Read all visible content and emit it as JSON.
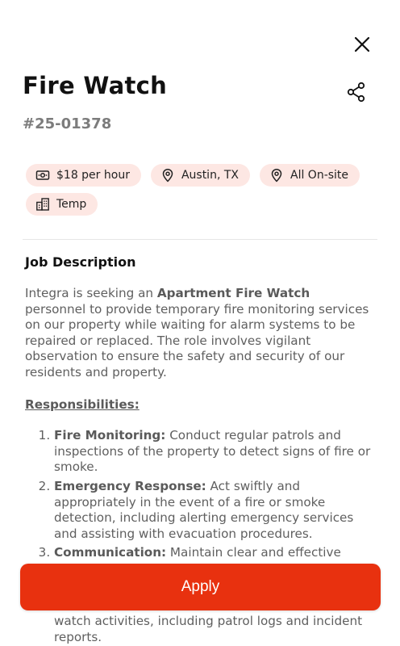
{
  "header": {
    "close_icon": "close-icon",
    "share_icon": "share-icon",
    "title": "Fire Watch",
    "job_id": "#25-01378"
  },
  "chips": [
    {
      "icon": "cash-icon",
      "label": "$18 per hour"
    },
    {
      "icon": "location-pin-icon",
      "label": "Austin, TX"
    },
    {
      "icon": "location-pin-icon",
      "label": "All On-site"
    },
    {
      "icon": "building-icon",
      "label": "Temp"
    }
  ],
  "description": {
    "section_title": "Job Description",
    "intro": {
      "part1": "Integra is seeking an ",
      "bold": "Apartment Fire Watch",
      "part2": " personnel to provide temporary fire monitoring services on our property while waiting for alarm systems to be repaired or replaced. The role involves vigilant observation to ensure the safety and security of our residents and property."
    },
    "responsibilities_title": "Responsibilities:",
    "responsibilities": [
      {
        "bold": "Fire Monitoring:",
        "text": " Conduct regular patrols and inspections of the property to detect signs of fire or smoke."
      },
      {
        "bold": "Emergency Response:",
        "text": " Act swiftly and appropriately in the event of a fire or smoke detection, including alerting emergency services and assisting with evacuation procedures."
      },
      {
        "bold": "Communication:",
        "text": " Maintain clear and effective"
      }
    ],
    "continued_text": "watch activities, including patrol logs and incident reports."
  },
  "actions": {
    "apply_label": "Apply"
  },
  "colors": {
    "accent": "#e8310f",
    "chip_background": "#fde7e3"
  }
}
